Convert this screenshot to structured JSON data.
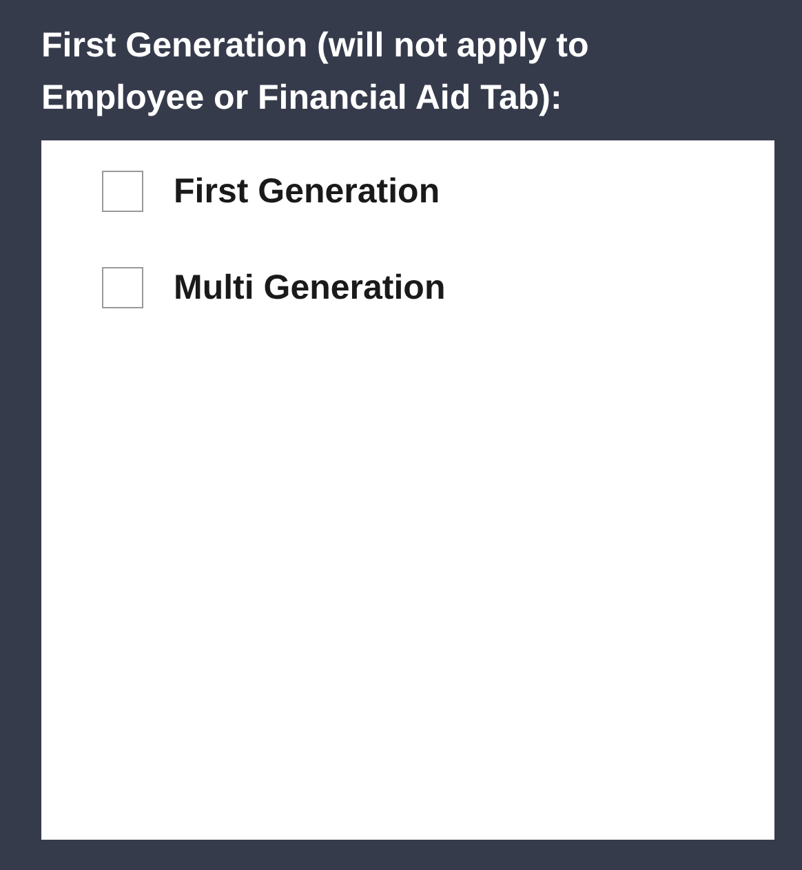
{
  "heading": "First Generation (will not apply to Employee or Financial Aid Tab):",
  "options": [
    {
      "label": "First Generation",
      "checked": false
    },
    {
      "label": "Multi Generation",
      "checked": false
    }
  ]
}
